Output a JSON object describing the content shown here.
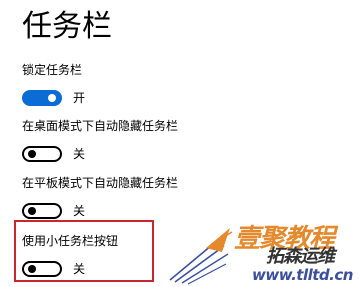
{
  "header": {
    "title": "任务栏"
  },
  "settings": [
    {
      "label": "锁定任务栏",
      "state": "on",
      "state_text": "开"
    },
    {
      "label": "在桌面模式下自动隐藏任务栏",
      "state": "off",
      "state_text": "关"
    },
    {
      "label": "在平板模式下自动隐藏任务栏",
      "state": "off",
      "state_text": "关"
    },
    {
      "label": "使用小任务栏按钮",
      "state": "off",
      "state_text": "关"
    }
  ],
  "watermark": {
    "title": "壹聚教程",
    "subtitle": "拓森运维",
    "url": "www.tlltd.cn"
  },
  "colors": {
    "toggle_on": "#0b6cd6",
    "highlight_border": "#c8282d",
    "watermark_orange": "#e48a2d",
    "watermark_blue": "#3b4f9c"
  }
}
